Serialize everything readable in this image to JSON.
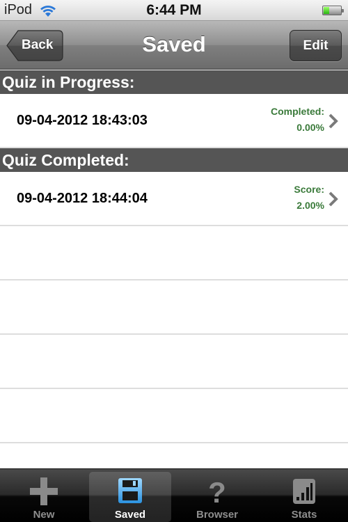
{
  "status_bar": {
    "carrier": "iPod",
    "time": "6:44 PM",
    "battery_level": 0.3
  },
  "nav": {
    "title": "Saved",
    "back_label": "Back",
    "edit_label": "Edit"
  },
  "sections": [
    {
      "header": "Quiz in Progress:",
      "rows": [
        {
          "title": "09-04-2012 18:43:03",
          "detail_label": "Completed:",
          "detail_value": "0.00%"
        }
      ]
    },
    {
      "header": "Quiz Completed:",
      "rows": [
        {
          "title": "09-04-2012 18:44:04",
          "detail_label": "Score:",
          "detail_value": "2.00%"
        }
      ]
    }
  ],
  "tabs": [
    {
      "label": "New",
      "icon": "plus-icon",
      "selected": false
    },
    {
      "label": "Saved",
      "icon": "floppy-disk-icon",
      "selected": true
    },
    {
      "label": "Browser",
      "icon": "question-mark-icon",
      "selected": false
    },
    {
      "label": "Stats",
      "icon": "bar-chart-icon",
      "selected": false
    }
  ],
  "colors": {
    "detail_green": "#3a7a3a",
    "section_header_bg": "#555555",
    "selected_tab_icon": "#3ea9ef"
  }
}
